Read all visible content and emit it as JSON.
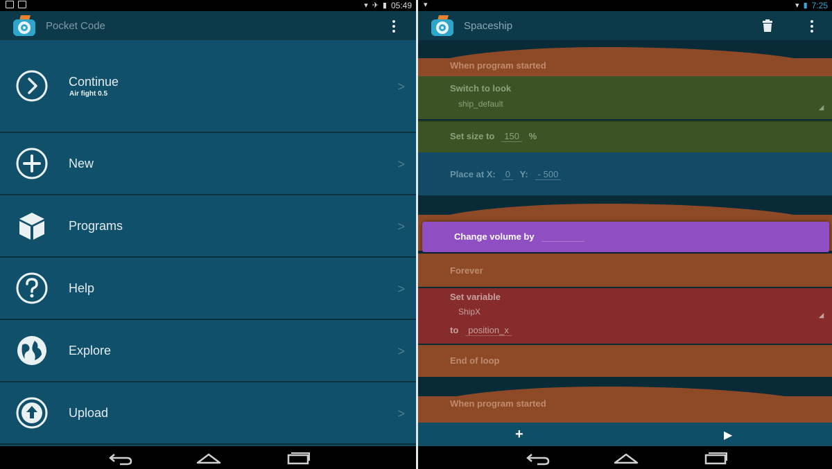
{
  "left": {
    "status": {
      "time": "05:49"
    },
    "app_title": "Pocket Code",
    "menu": [
      {
        "label": "Continue",
        "subtitle": "Air fight 0.5",
        "icon": "chevron-circle-icon"
      },
      {
        "label": "New",
        "icon": "plus-circle-icon"
      },
      {
        "label": "Programs",
        "icon": "cube-icon"
      },
      {
        "label": "Help",
        "icon": "question-circle-icon"
      },
      {
        "label": "Explore",
        "icon": "globe-icon"
      },
      {
        "label": "Upload",
        "icon": "upload-circle-icon"
      }
    ],
    "arrow": ">"
  },
  "right": {
    "status": {
      "time": "7:25"
    },
    "title": "Spaceship",
    "bricks": {
      "when_started_1": "When program started",
      "switch_look": "Switch to look",
      "look_value": "ship_default",
      "set_size": "Set size to",
      "size_value": "150",
      "size_unit": "%",
      "place_at_x": "Place at X:",
      "x_value": "0",
      "y_label": "Y:",
      "y_value": "- 500",
      "change_volume": "Change volume by",
      "forever": "Forever",
      "set_variable": "Set variable",
      "variable_name": "ShipX",
      "to_label": "to",
      "to_value": "position_x",
      "end_of_loop": "End of loop",
      "when_started_2": "When program started"
    },
    "bottom": {
      "add": "+",
      "play": "▶"
    }
  },
  "colors": {
    "menu_bg": "#11506a",
    "actionbar_bg": "#0d3a4a",
    "event_brick": "#8e4a26",
    "look_brick": "#3c5425",
    "motion_brick": "#134b66",
    "sound_brick": "#8f4fc2",
    "data_brick": "#862c2c"
  }
}
